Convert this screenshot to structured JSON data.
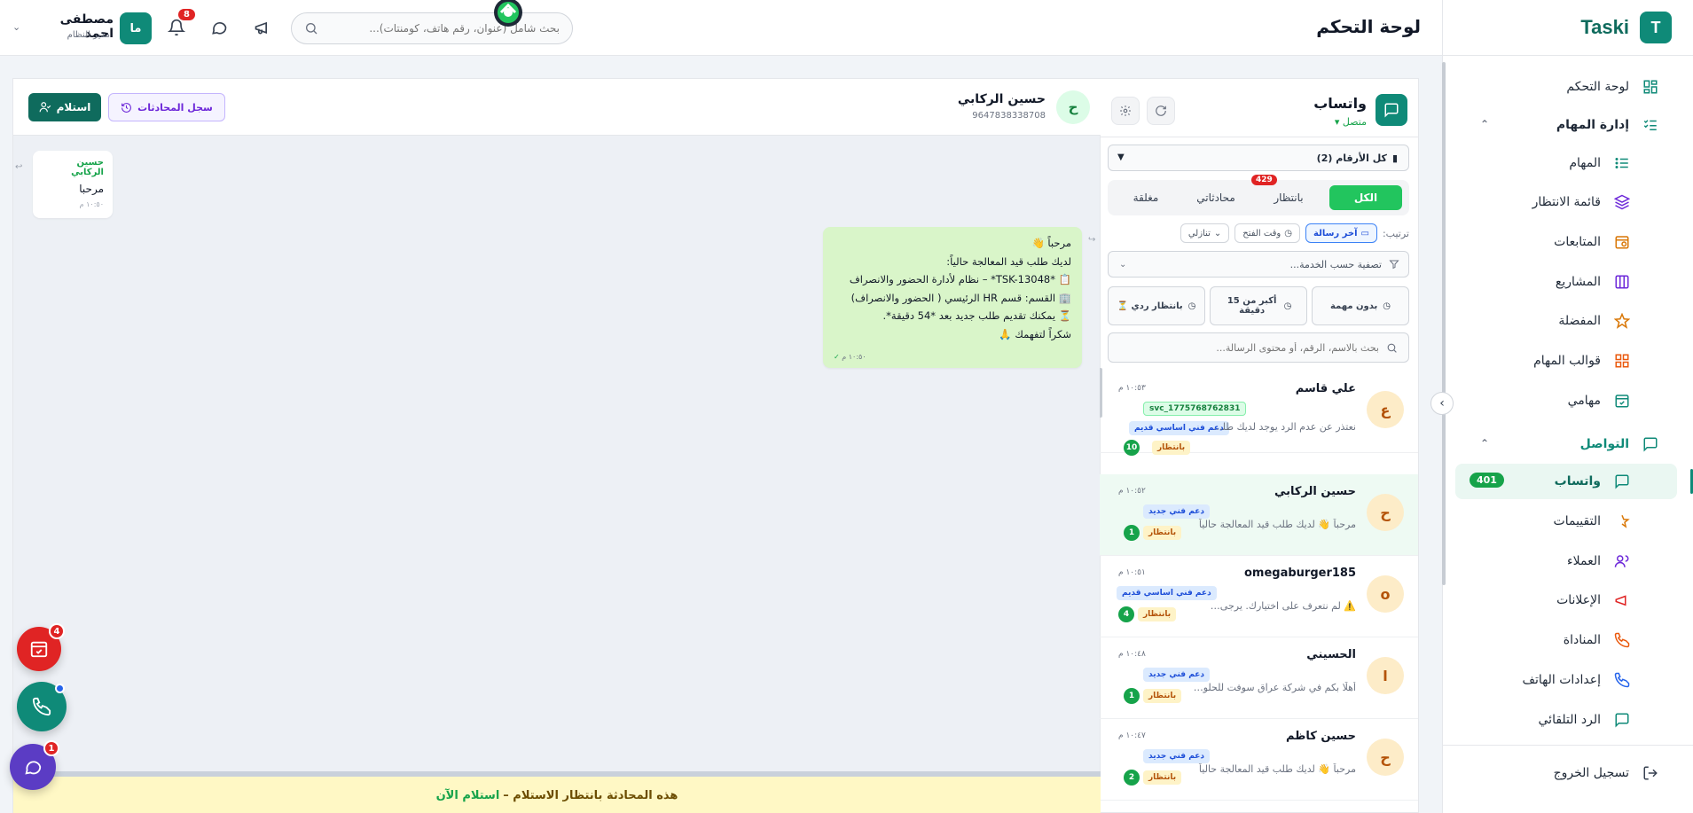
{
  "header": {
    "page_title": "لوحة التحكم",
    "search_placeholder": "بحث شامل (عنوان، رقم هاتف، كومنتات)...",
    "notifications_count": "8",
    "user": {
      "initials": "ما",
      "name": "مصطفى احمد",
      "role": "مدير النظام"
    }
  },
  "sidebar": {
    "brand_letter": "T",
    "brand_name": "Taski",
    "items": [
      {
        "label": "لوحة التحكم",
        "icon": "dashboard-icon"
      },
      {
        "label": "إدارة المهام",
        "icon": "task-list-icon"
      },
      {
        "label": "المهام",
        "icon": "checklist-icon"
      },
      {
        "label": "قائمة الانتظار",
        "icon": "layers-icon"
      },
      {
        "label": "المتابعات",
        "icon": "calendar-clock-icon"
      },
      {
        "label": "المشاريع",
        "icon": "kanban-icon"
      },
      {
        "label": "المفضلة",
        "icon": "star-icon"
      },
      {
        "label": "قوالب المهام",
        "icon": "template-icon"
      },
      {
        "label": "مهامي",
        "icon": "calendar-check-icon"
      },
      {
        "label": "التواصل",
        "icon": "chat-icon"
      },
      {
        "label": "واتساب",
        "icon": "whatsapp-chat-icon",
        "badge": "401"
      },
      {
        "label": "التقييمات",
        "icon": "rating-icon"
      },
      {
        "label": "العملاء",
        "icon": "users-icon"
      },
      {
        "label": "الإعلانات",
        "icon": "megaphone-icon"
      },
      {
        "label": "المناداة",
        "icon": "phone-ring-icon"
      },
      {
        "label": "إعدادات الهاتف",
        "icon": "phone-icon"
      },
      {
        "label": "الرد التلقائي",
        "icon": "auto-reply-icon"
      }
    ],
    "logout": "تسجيل الخروج"
  },
  "whatsapp": {
    "title": "واتساب",
    "status": "متصل",
    "numbers_select": "كل الأرقام (2)",
    "tabs": [
      {
        "label": "الكل"
      },
      {
        "label": "بانتظار",
        "badge": "429"
      },
      {
        "label": "محادثاتي"
      },
      {
        "label": "مغلقة"
      }
    ],
    "sort_label": "ترتيب:",
    "sort_options": [
      "آخر رسالة",
      "وقت الفتح",
      "تنازلي"
    ],
    "service_filter": "تصفية حسب الخدمة...",
    "quick_filters": [
      "بدون مهمة",
      "أكبر من 15 دقيقة",
      "بانتظار ردي ⏳"
    ],
    "search_placeholder": "بحث بالاسم، الرقم، أو محتوى الرسالة...",
    "conversations": [
      {
        "initial": "ع",
        "name": "علي قاسم",
        "time": "١٠:٥٣ م",
        "svc": "svc_1775768762831",
        "tag": "دعم فني اساسي قديم",
        "preview": "نعتذر عن عدم الرد يوجد لديك طلب قيد المعالجة",
        "status": "بانتظار",
        "count": "10"
      },
      {
        "initial": "ح",
        "name": "حسين الركابي",
        "time": "١٠:٥٢ م",
        "tag": "دعم فني جديد",
        "preview": "مرحباً 👋 لديك طلب قيد المعالجة حالياً",
        "status": "بانتظار",
        "count": "1"
      },
      {
        "initial": "o",
        "name": "omegaburger185",
        "time": "١٠:٥١ م",
        "tag": "دعم فني اساسي قديم",
        "preview": "⚠️ لم نتعرف على اختيارك. يرجى اختيار رقم من القائمة",
        "status": "بانتظار",
        "count": "4"
      },
      {
        "initial": "ا",
        "name": "الحسيني",
        "time": "١٠:٤٨ م",
        "tag": "دعم فني جديد",
        "preview": "أهلًا بكم في شركة عراق سوفت للحلول البرمجية",
        "status": "بانتظار",
        "count": "1"
      },
      {
        "initial": "ح",
        "name": "حسين كاظم",
        "time": "١٠:٤٧ م",
        "tag": "دعم فني جديد",
        "preview": "مرحباً 👋 لديك طلب قيد المعالجة حالياً",
        "status": "بانتظار",
        "count": "2"
      }
    ]
  },
  "chat": {
    "contact_initial": "ح",
    "contact_name": "حسين الركابي",
    "contact_phone": "9647838338708",
    "receive_button": "استلام",
    "history_button": "سجل المحادثات",
    "incoming": {
      "sender": "حسين الركابي",
      "text": "مرحبا",
      "time": "١٠:٥٠ م"
    },
    "outgoing": {
      "lines": [
        "مرحباً 👋",
        "لديك طلب قيد المعالجة حالياً:",
        "📋 *TSK-13048* – نظام لأدارة الحضور والانصراف",
        "🏢 القسم: قسم HR الرئيسي ( الحضور والانصراف)",
        "⏳ يمكنك تقديم طلب جديد بعد *54 دقيقة*.",
        "شكراً لتفهمك 🙏"
      ],
      "time": "١٠:٥٠ م"
    },
    "pending_text": "هذه المحادثة بانتظار الاستلام –",
    "pending_link": "استلام الآن"
  },
  "floating": {
    "tasks_badge": "4",
    "chat_badge": "1"
  },
  "colors": {
    "primary": "#0f8a78",
    "accent_green": "#22c55e",
    "danger": "#e02424"
  }
}
